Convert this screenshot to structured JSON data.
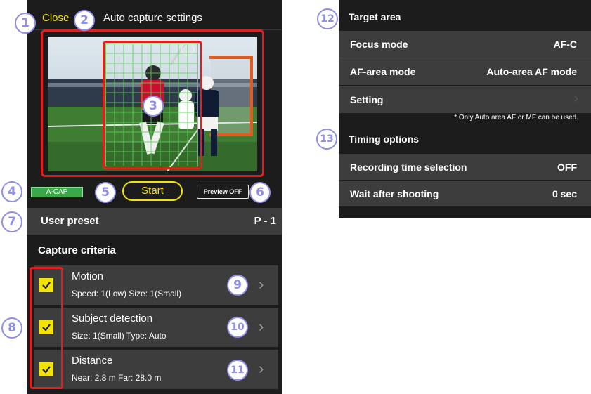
{
  "left_screen": {
    "close_label": "Close",
    "title": "Auto capture settings",
    "acap_badge": "A-CAP",
    "start_label": "Start",
    "preview_label": "Preview OFF",
    "user_preset_label": "User preset",
    "user_preset_value": "P - 1",
    "capture_criteria_heading": "Capture criteria",
    "criteria": [
      {
        "title": "Motion",
        "detail": "Speed: 1(Low)   Size: 1(Small)",
        "checked": true
      },
      {
        "title": "Subject detection",
        "detail": "Size: 1(Small)   Type: Auto",
        "checked": true
      },
      {
        "title": "Distance",
        "detail": "Near: 2.8 m   Far: 28.0 m",
        "checked": true
      }
    ]
  },
  "right_screen": {
    "target_area_heading": "Target area",
    "focus_mode_label": "Focus mode",
    "focus_mode_value": "AF-C",
    "af_area_label": "AF-area mode",
    "af_area_value": "Auto-area AF mode",
    "setting_label": "Setting",
    "note": "* Only Auto area AF or MF can be used.",
    "timing_heading": "Timing options",
    "recording_label": "Recording time selection",
    "recording_value": "OFF",
    "wait_label": "Wait after shooting",
    "wait_value": "0 sec"
  },
  "callouts": [
    "1",
    "2",
    "3",
    "4",
    "5",
    "6",
    "7",
    "8",
    "9",
    "10",
    "11",
    "12",
    "13"
  ],
  "colors": {
    "accent_yellow": "#f2e400",
    "highlight_red": "#e0201e",
    "callout_purple": "#8f8fe8",
    "acap_green": "#3aa84a",
    "panel_bg": "#1c1c1c",
    "row_bg": "#3d3d3d",
    "grid_green": "#5bd15b"
  },
  "icons": [
    "check-icon",
    "chevron-right-icon"
  ]
}
